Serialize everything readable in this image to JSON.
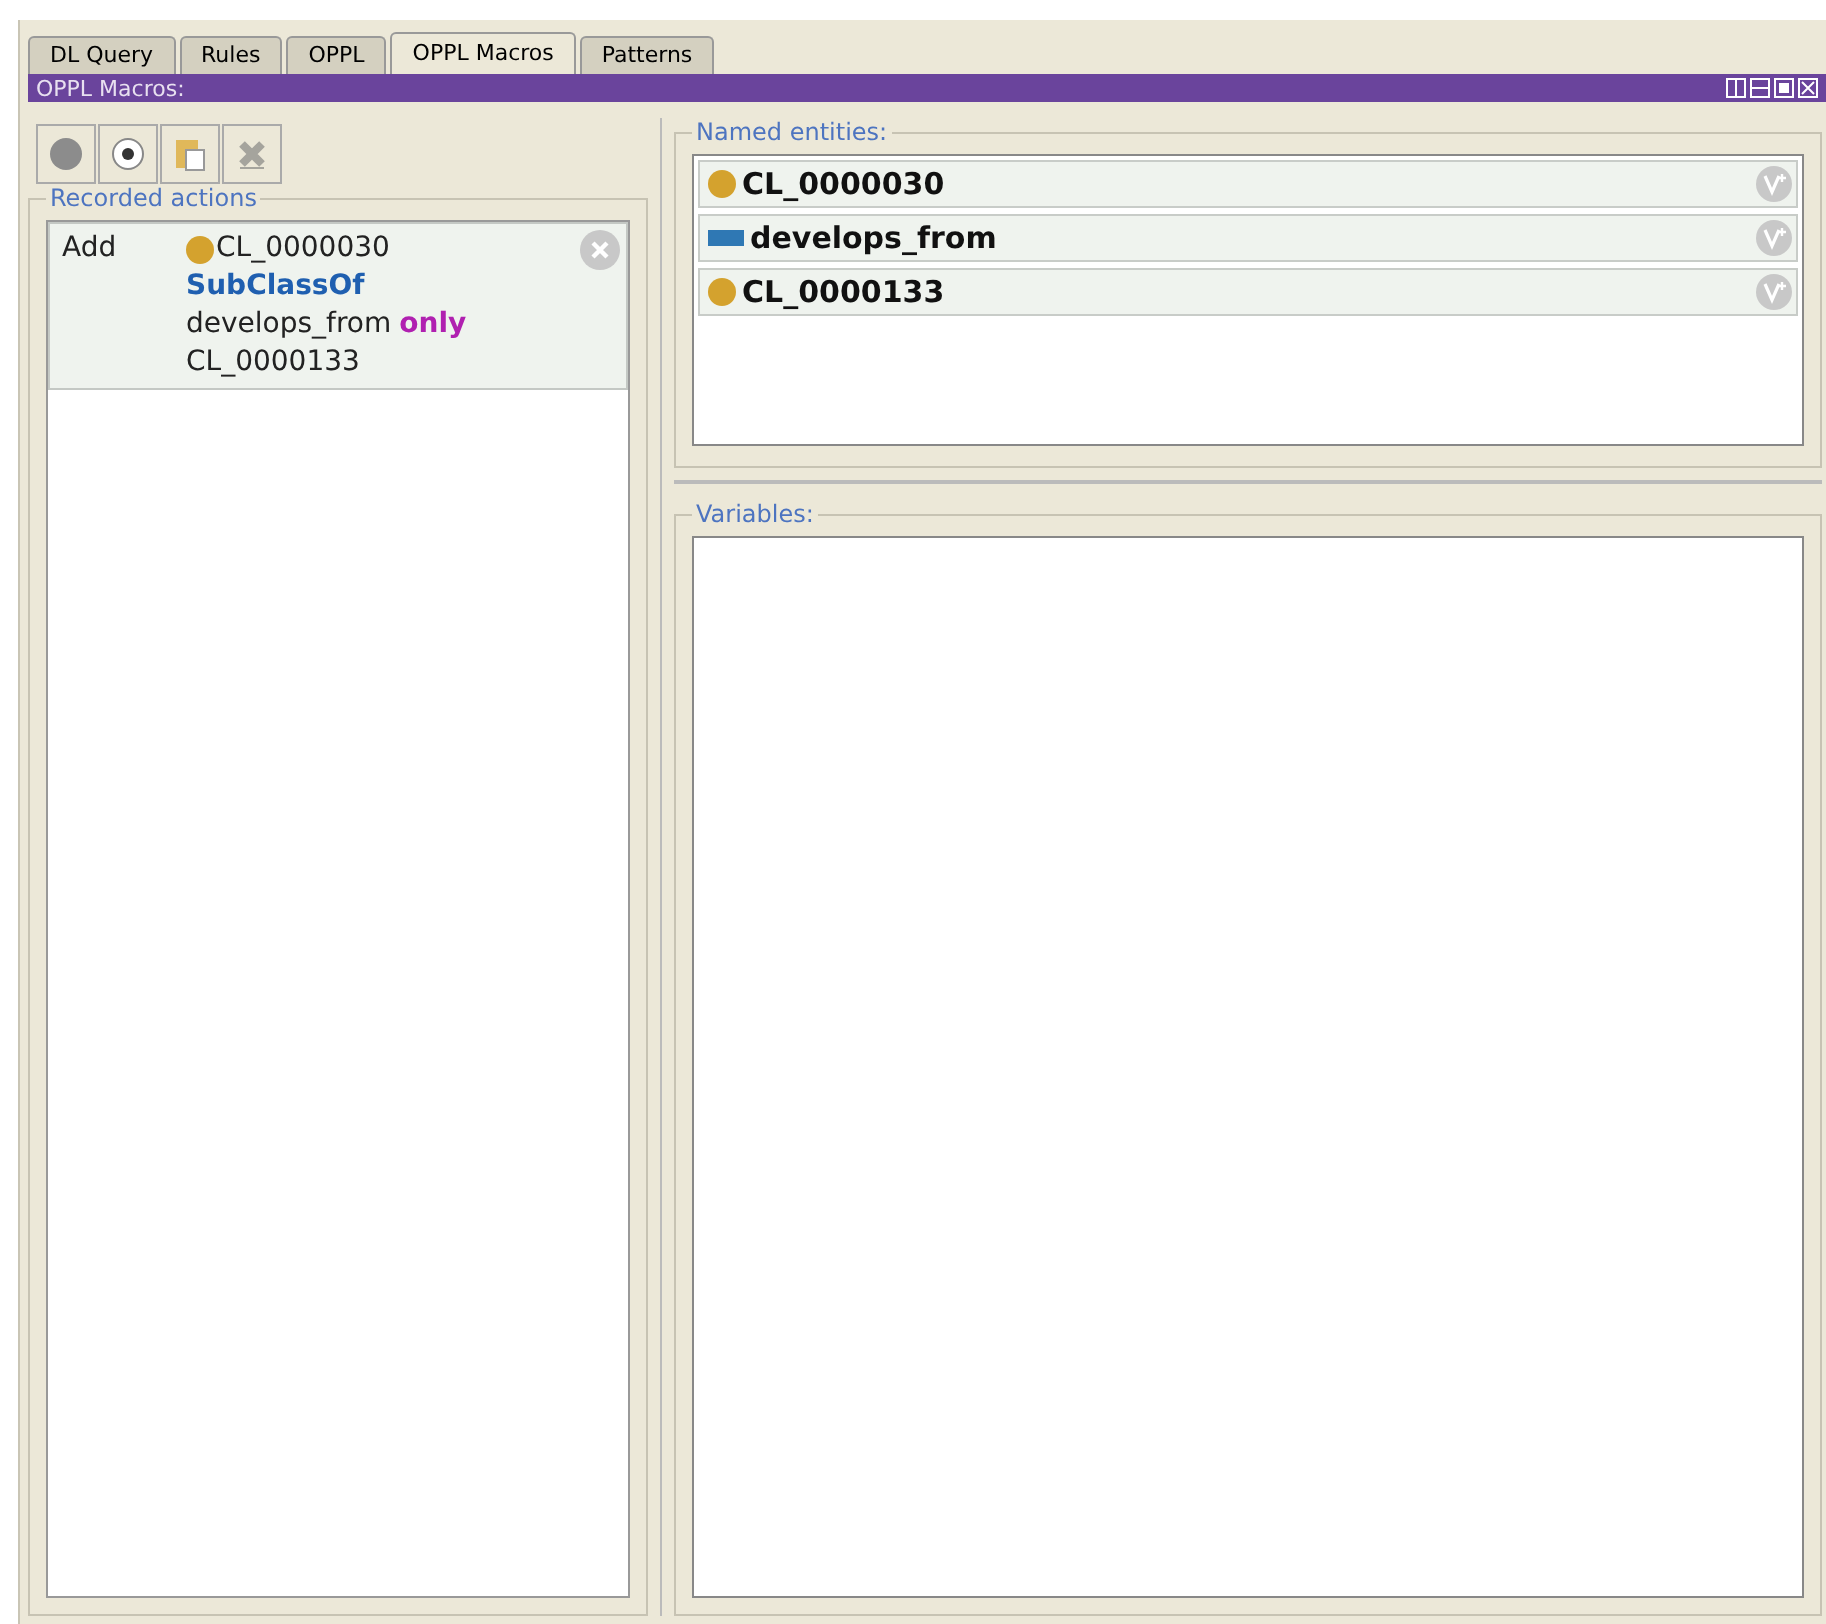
{
  "tabs": [
    {
      "label": "DL Query",
      "selected": false
    },
    {
      "label": "Rules",
      "selected": false
    },
    {
      "label": "OPPL",
      "selected": false
    },
    {
      "label": "OPPL Macros",
      "selected": true
    },
    {
      "label": "Patterns",
      "selected": false
    }
  ],
  "view": {
    "title": "OPPL Macros:"
  },
  "toolbar": [
    {
      "kind": "record",
      "disabled": false
    },
    {
      "kind": "stop",
      "disabled": false
    },
    {
      "kind": "paste",
      "disabled": false
    },
    {
      "kind": "clear",
      "disabled": true
    }
  ],
  "recorded_actions": {
    "title": "Recorded actions",
    "items": [
      {
        "action": "Add",
        "lines": [
          [
            {
              "kind": "class",
              "text": "CL_0000030"
            }
          ],
          [
            {
              "kind": "keyword",
              "text": "SubClassOf"
            }
          ],
          [
            {
              "kind": "plain",
              "text": "develops_from"
            },
            {
              "kind": "restriction",
              "text": "only"
            }
          ],
          [
            {
              "kind": "plain",
              "text": "CL_0000133"
            }
          ]
        ]
      }
    ]
  },
  "named_entities": {
    "title": "Named entities:",
    "items": [
      {
        "kind": "class",
        "name": "CL_0000030"
      },
      {
        "kind": "property",
        "name": "develops_from"
      },
      {
        "kind": "class",
        "name": "CL_0000133"
      }
    ]
  },
  "variables": {
    "title": "Variables:"
  }
}
